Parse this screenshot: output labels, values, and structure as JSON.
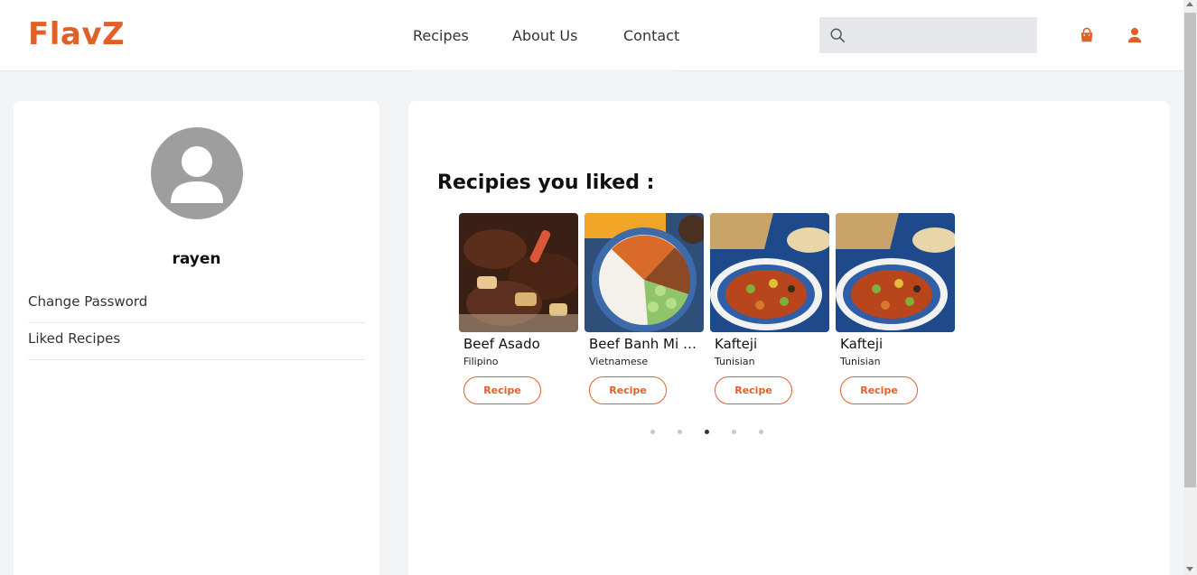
{
  "brand": {
    "logo": "FlavZ",
    "accent": "#e0602a"
  },
  "nav": {
    "links": [
      "Recipes",
      "About Us",
      "Contact"
    ],
    "search_placeholder": "",
    "icons": [
      "search-icon",
      "shopping-bag-icon",
      "user-icon"
    ]
  },
  "profile": {
    "username": "rayen",
    "menu": [
      "Change Password",
      "Liked Recipes"
    ]
  },
  "liked": {
    "title": "Recipies you liked :",
    "recipes": [
      {
        "name": "Beef Asado",
        "cuisine": "Filipino",
        "button": "Recipe"
      },
      {
        "name": "Beef Banh Mi Bowls with Sriracha Mayo",
        "cuisine": "Vietnamese",
        "button": "Recipe"
      },
      {
        "name": "Kafteji",
        "cuisine": "Tunisian",
        "button": "Recipe"
      },
      {
        "name": "Kafteji",
        "cuisine": "Tunisian",
        "button": "Recipe"
      }
    ],
    "pagination": {
      "pages": 5,
      "active": 3
    }
  }
}
